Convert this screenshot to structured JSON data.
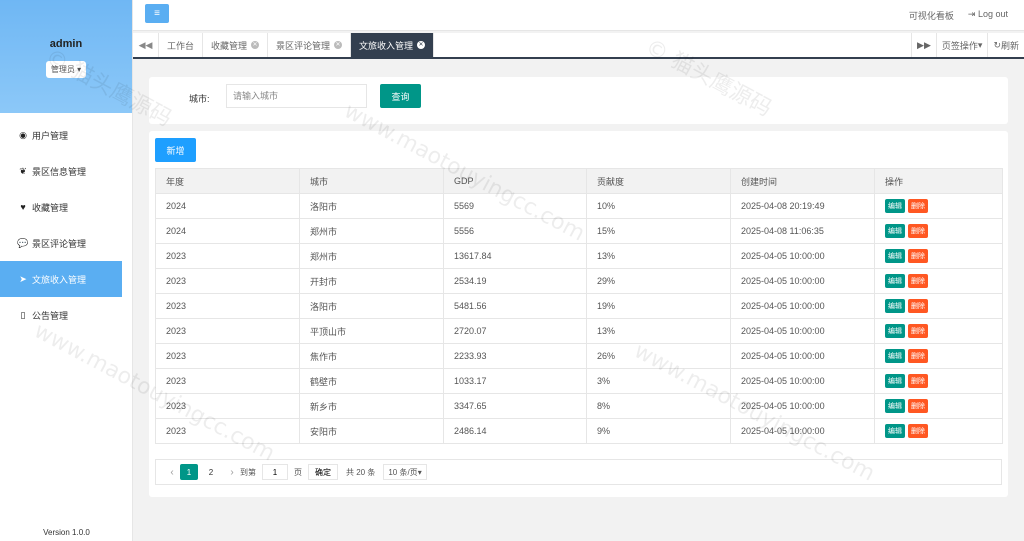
{
  "sidebar": {
    "username": "admin",
    "role": "管理员",
    "items": [
      {
        "label": "用户管理",
        "icon": "user-circle-icon"
      },
      {
        "label": "景区信息管理",
        "icon": "leaf-icon"
      },
      {
        "label": "收藏管理",
        "icon": "heart-icon"
      },
      {
        "label": "景区评论管理",
        "icon": "comment-icon"
      },
      {
        "label": "文旅收入管理",
        "icon": "paper-plane-icon",
        "active": true
      },
      {
        "label": "公告管理",
        "icon": "map-icon"
      }
    ],
    "version": "Version 1.0.0"
  },
  "topbar": {
    "dashboard": "可视化看板",
    "logout": "Log out"
  },
  "tabs": {
    "items": [
      {
        "label": "工作台"
      },
      {
        "label": "收藏管理"
      },
      {
        "label": "景区评论管理"
      },
      {
        "label": "文旅收入管理",
        "active": true
      }
    ],
    "page_ops": "页签操作",
    "refresh": "刷新"
  },
  "search": {
    "label": "城市:",
    "placeholder": "请输入城市",
    "button": "查询"
  },
  "toolbar": {
    "add": "新增"
  },
  "table": {
    "headers": [
      "年度",
      "城市",
      "GDP",
      "贡献度",
      "创建时间",
      "操作"
    ],
    "edit_label": "编辑",
    "delete_label": "删除",
    "rows": [
      [
        "2024",
        "洛阳市",
        "5569",
        "10%",
        "2025-04-08 20:19:49"
      ],
      [
        "2024",
        "郑州市",
        "5556",
        "15%",
        "2025-04-08 11:06:35"
      ],
      [
        "2023",
        "郑州市",
        "13617.84",
        "13%",
        "2025-04-05 10:00:00"
      ],
      [
        "2023",
        "开封市",
        "2534.19",
        "29%",
        "2025-04-05 10:00:00"
      ],
      [
        "2023",
        "洛阳市",
        "5481.56",
        "19%",
        "2025-04-05 10:00:00"
      ],
      [
        "2023",
        "平顶山市",
        "2720.07",
        "13%",
        "2025-04-05 10:00:00"
      ],
      [
        "2023",
        "焦作市",
        "2233.93",
        "26%",
        "2025-04-05 10:00:00"
      ],
      [
        "2023",
        "鹤壁市",
        "1033.17",
        "3%",
        "2025-04-05 10:00:00"
      ],
      [
        "2023",
        "新乡市",
        "3347.65",
        "8%",
        "2025-04-05 10:00:00"
      ],
      [
        "2023",
        "安阳市",
        "2486.14",
        "9%",
        "2025-04-05 10:00:00"
      ]
    ]
  },
  "pager": {
    "pages": [
      "1",
      "2"
    ],
    "current": "1",
    "goto_prefix": "到第",
    "goto_value": "1",
    "goto_suffix": "页",
    "confirm": "确定",
    "total": "共 20 条",
    "page_size": "10 条/页"
  },
  "watermark": "© 猫头鹰源码 www.maotouyingcc.com"
}
